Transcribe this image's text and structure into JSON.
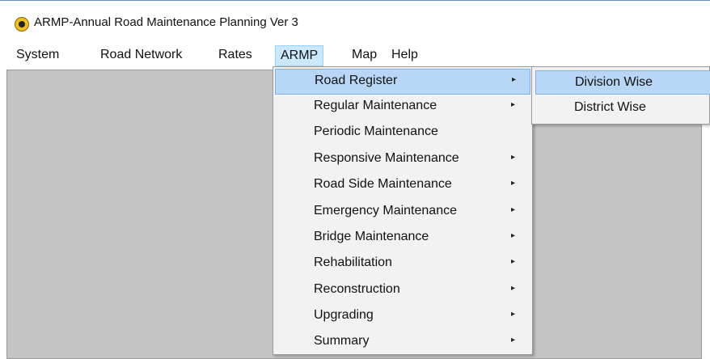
{
  "window": {
    "title": "ARMP-Annual Road Maintenance Planning Ver 3",
    "icon": "app-road-sign-icon"
  },
  "menubar": {
    "items": [
      {
        "label": "System"
      },
      {
        "label": "Road Network"
      },
      {
        "label": "Rates"
      },
      {
        "label": "ARMP"
      },
      {
        "label": "Map"
      },
      {
        "label": "Help"
      }
    ],
    "active": "ARMP"
  },
  "armp_menu": {
    "items": [
      {
        "label": "Road Register",
        "has_submenu": true,
        "highlighted": true
      },
      {
        "label": "Regular Maintenance",
        "has_submenu": true
      },
      {
        "label": "Periodic Maintenance",
        "has_submenu": false
      },
      {
        "label": "Responsive Maintenance",
        "has_submenu": true
      },
      {
        "label": "Road Side Maintenance",
        "has_submenu": true
      },
      {
        "label": "Emergency Maintenance",
        "has_submenu": true
      },
      {
        "label": "Bridge Maintenance",
        "has_submenu": true
      },
      {
        "label": "Rehabilitation",
        "has_submenu": true
      },
      {
        "label": "Reconstruction",
        "has_submenu": true
      },
      {
        "label": "Upgrading",
        "has_submenu": true
      },
      {
        "label": "Summary",
        "has_submenu": true
      }
    ],
    "submenu_arrow": "▸"
  },
  "road_register_submenu": {
    "items": [
      {
        "label": "Division Wise",
        "highlighted": true
      },
      {
        "label": "District Wise"
      }
    ]
  },
  "colors": {
    "highlight": "#b8d6f5",
    "menubar_active": "#cce8ff",
    "client_background": "#c4c4c4",
    "menu_background": "#f2f2f2"
  }
}
